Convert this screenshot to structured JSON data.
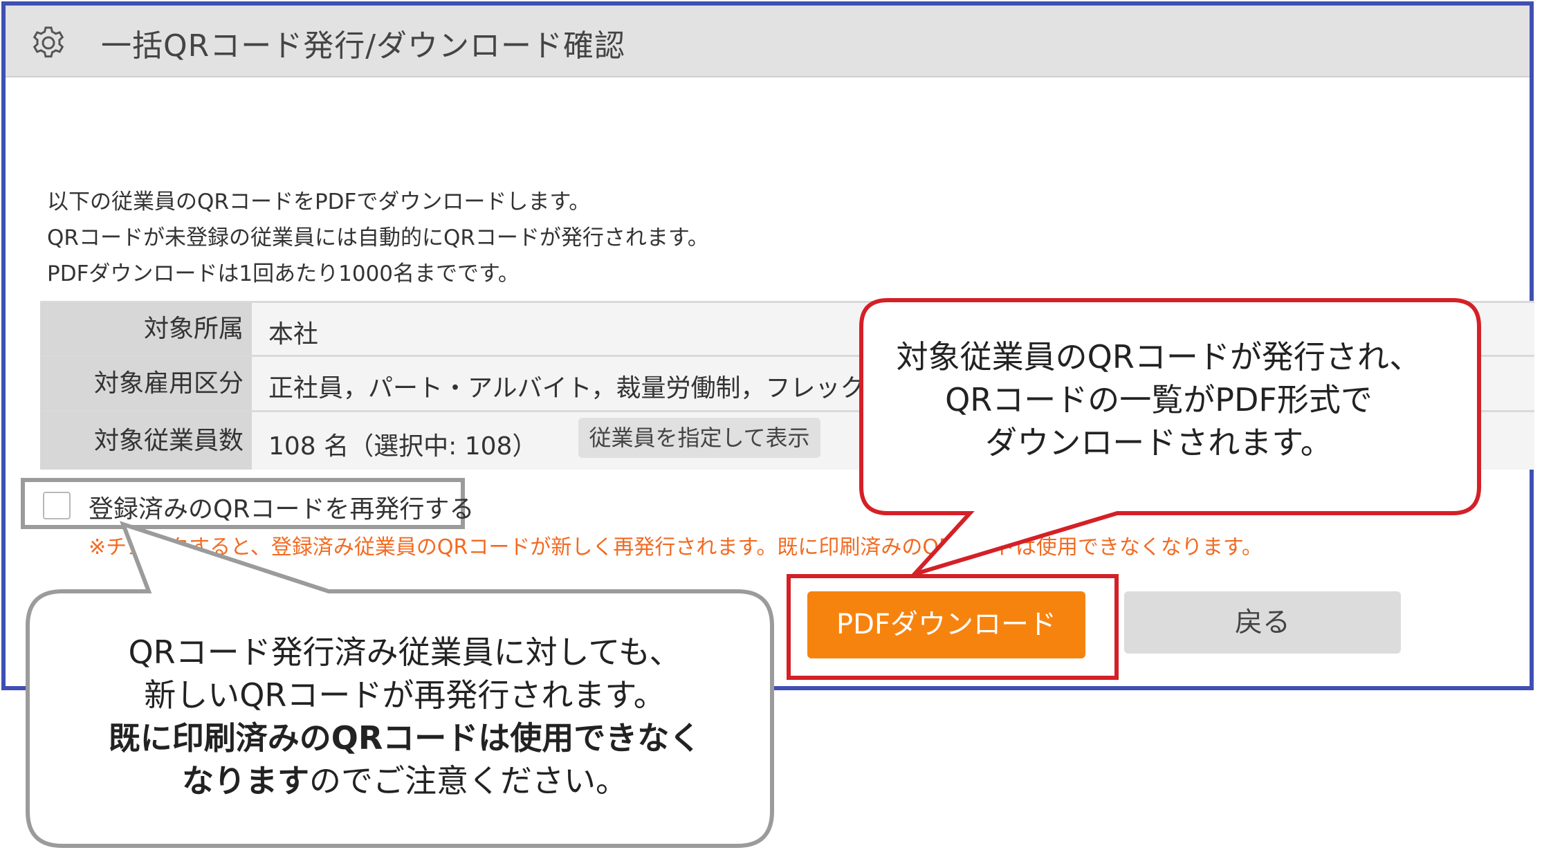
{
  "window": {
    "title": "一括QRコード発行/ダウンロード確認",
    "accent_border": "#3f4fb3"
  },
  "icons": {
    "settings": "gear-icon"
  },
  "description": {
    "line1": "以下の従業員のQRコードをPDFでダウンロードします。",
    "line2": "QRコードが未登録の従業員には自動的にQRコードが発行されます。",
    "line3": "PDFダウンロードは1回あたり1000名までです。"
  },
  "table": {
    "affiliation": {
      "label": "対象所属",
      "value": "本社"
    },
    "employment_type": {
      "label": "対象雇用区分",
      "value": "正社員，パート・アルバイト，裁量労働制，フレックス，"
    },
    "employee_count": {
      "label": "対象従業員数",
      "value": "108 名（選択中: 108）",
      "show_button": "従業員を指定して表示"
    }
  },
  "reissue": {
    "label": "登録済みのQRコードを再発行する",
    "checked": false,
    "warning": "※チェックすると、登録済み従業員のQRコードが新しく再発行されます。既に印刷済みのQRコードは使用できなくなります。"
  },
  "buttons": {
    "pdf_download": "PDFダウンロード",
    "back": "戻る",
    "pdf_color": "#f7830f"
  },
  "callouts": {
    "right": {
      "line1": "対象従業員のQRコードが発行され、",
      "line2": "QRコードの一覧がPDF形式で",
      "line3": "ダウンロードされます。",
      "border_color": "#d42027"
    },
    "left": {
      "line1": "QRコード発行済み従業員に対しても、",
      "line2": "新しいQRコードが再発行されます。",
      "line3": "既に印刷済みのQRコードは使用できなく",
      "line4_bold": "なります",
      "line4_rest": "のでご注意ください。",
      "border_color": "#9b9b9b"
    }
  }
}
